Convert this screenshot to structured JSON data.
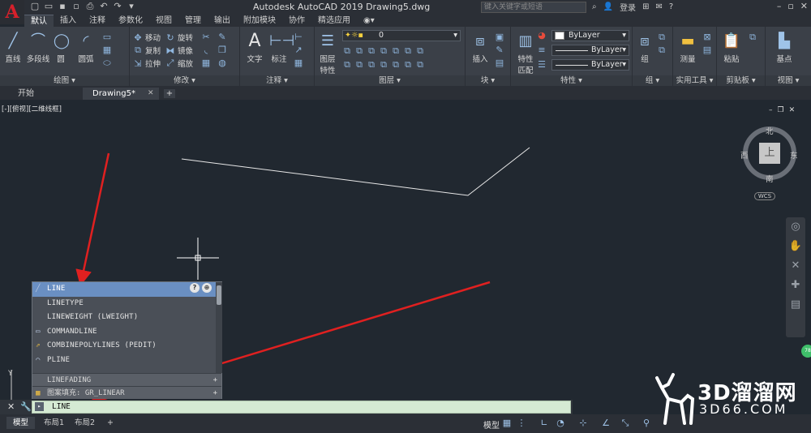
{
  "titlebar": {
    "logo": "A",
    "title": "Autodesk AutoCAD 2019    Drawing5.dwg",
    "search_placeholder": "键入关键字或短语",
    "login": "登录",
    "qat_icons": [
      "new-file-icon",
      "open-file-icon",
      "save-icon",
      "save-as-icon",
      "print-icon",
      "undo-icon",
      "redo-icon",
      "share-icon"
    ]
  },
  "ribbon_tabs": [
    "默认",
    "插入",
    "注释",
    "参数化",
    "视图",
    "管理",
    "输出",
    "附加模块",
    "协作",
    "精选应用"
  ],
  "ribbon": {
    "draw": {
      "title": "绘图",
      "line": "直线",
      "polyline": "多段线",
      "circle": "圆",
      "arc": "圆弧"
    },
    "modify": {
      "title": "修改",
      "move": "移动",
      "rotate": "旋转",
      "copy": "复制",
      "mirror": "镜像",
      "stretch": "拉伸",
      "scale": "缩放"
    },
    "annotation": {
      "title": "注释",
      "text": "文字",
      "dimension": "标注"
    },
    "layers": {
      "title": "图层",
      "layer_props_1": "图层",
      "layer_props_2": "特性",
      "layer_value": "0"
    },
    "block": {
      "title": "块",
      "insert": "插入"
    },
    "properties": {
      "title": "特性",
      "match_1": "特性",
      "match_2": "匹配",
      "color": "ByLayer",
      "linetype": "ByLayer",
      "lineweight": "ByLayer"
    },
    "groups": {
      "title": "组",
      "group": "组"
    },
    "utilities": {
      "title": "实用工具",
      "measure": "测量"
    },
    "clipboard": {
      "title": "剪贴板",
      "paste": "粘贴"
    },
    "view": {
      "title": "视图",
      "base": "基点"
    }
  },
  "file_tabs": {
    "start": "开始",
    "drawing": "Drawing5*"
  },
  "viewport": {
    "label": "[-][俯视][二维线框]",
    "cube_top": "上",
    "north": "北",
    "south": "南",
    "east": "东",
    "west": "西",
    "wcs": "WCS"
  },
  "autocomplete": {
    "items": [
      {
        "label": "LINE",
        "icon": "line-icon"
      },
      {
        "label": "LINETYPE",
        "icon": ""
      },
      {
        "label": "LINEWEIGHT (LWEIGHT)",
        "icon": ""
      },
      {
        "label": "COMMANDLINE",
        "icon": "commandline-icon"
      },
      {
        "label": "COMBINEPOLYLINES (PEDIT)",
        "icon": "pedit-icon"
      },
      {
        "label": "PLINE",
        "icon": "pline-icon"
      }
    ],
    "group1": "LINEFADING",
    "group2": "图案填充: GR_LINEAR"
  },
  "commandline": {
    "value": "LINE"
  },
  "status": {
    "tabs": [
      "模型",
      "布局1",
      "布局2"
    ],
    "model_button": "模型"
  },
  "watermark": {
    "title": "3D溜溜网",
    "sub": "3D66.COM"
  },
  "badge": "78",
  "colors": {
    "accent": "#6a8fc2",
    "background": "#212830",
    "arrow": "#e02020",
    "cmd_bg": "#d5ead3"
  }
}
